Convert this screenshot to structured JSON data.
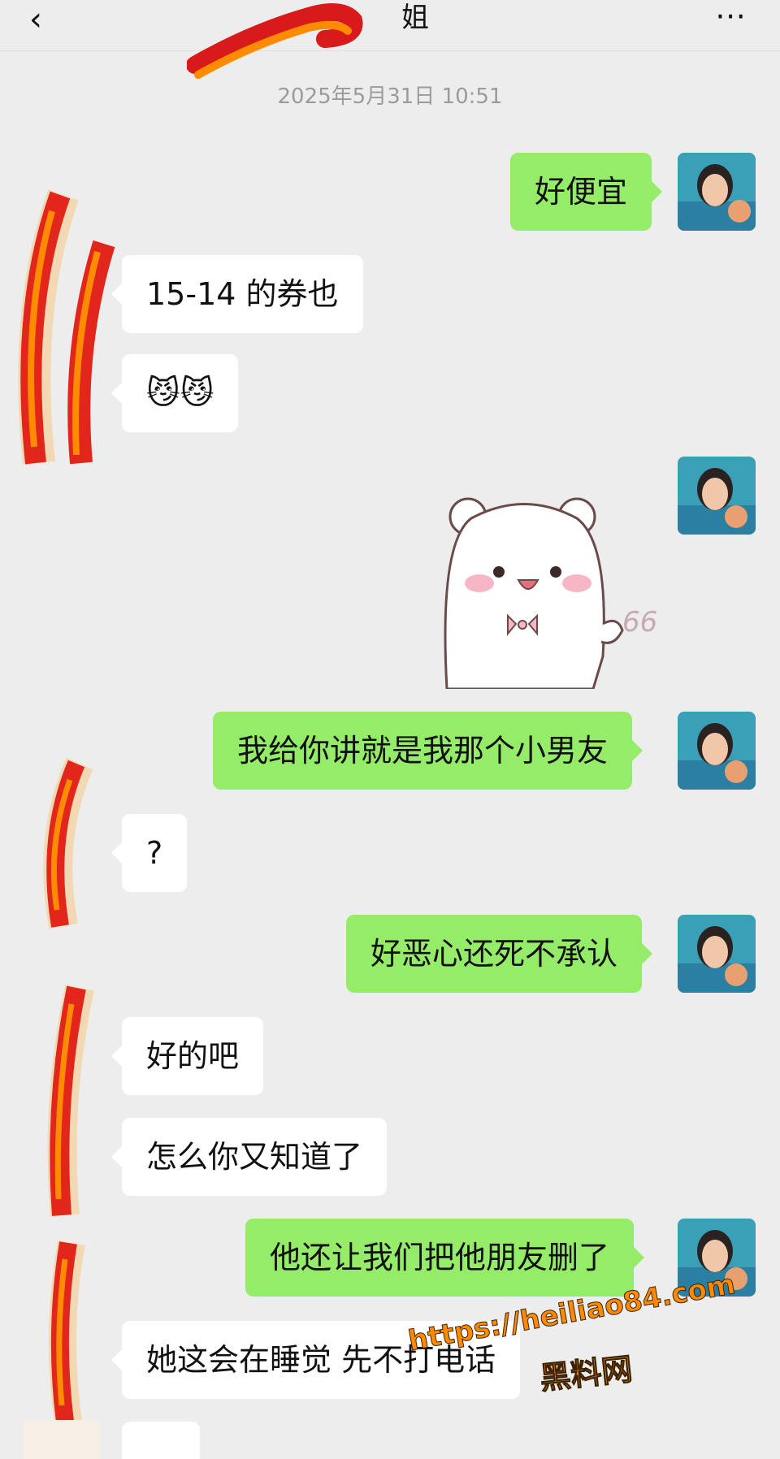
{
  "header": {
    "back_icon": "chevron-left-icon",
    "title": "姐",
    "more_icon": "more-dots-icon"
  },
  "timestamp": "2025年5月31日 10:51",
  "messages": [
    {
      "side": "me",
      "text": "好便宜"
    },
    {
      "side": "them",
      "text": "15-14 的券也"
    },
    {
      "side": "them",
      "text": "😼😼"
    },
    {
      "side": "me",
      "type": "sticker",
      "sticker_caption": "66"
    },
    {
      "side": "me",
      "text": "我给你讲就是我那个小男友"
    },
    {
      "side": "them",
      "text": "?"
    },
    {
      "side": "me",
      "text": "好恶心还死不承认"
    },
    {
      "side": "them",
      "text": "好的吧"
    },
    {
      "side": "them",
      "text": "怎么你又知道了"
    },
    {
      "side": "me",
      "text": "他还让我们把他朋友删了"
    },
    {
      "side": "them",
      "text": "她这会在睡觉 先不打电话"
    }
  ],
  "watermark": {
    "line1": "https://heiliao84.com",
    "line2": "黑料网"
  },
  "colors": {
    "background": "#ededed",
    "my_bubble": "#95ec69",
    "their_bubble": "#ffffff",
    "timestamp": "#9b9b9b",
    "watermark": "#ff8a00"
  }
}
